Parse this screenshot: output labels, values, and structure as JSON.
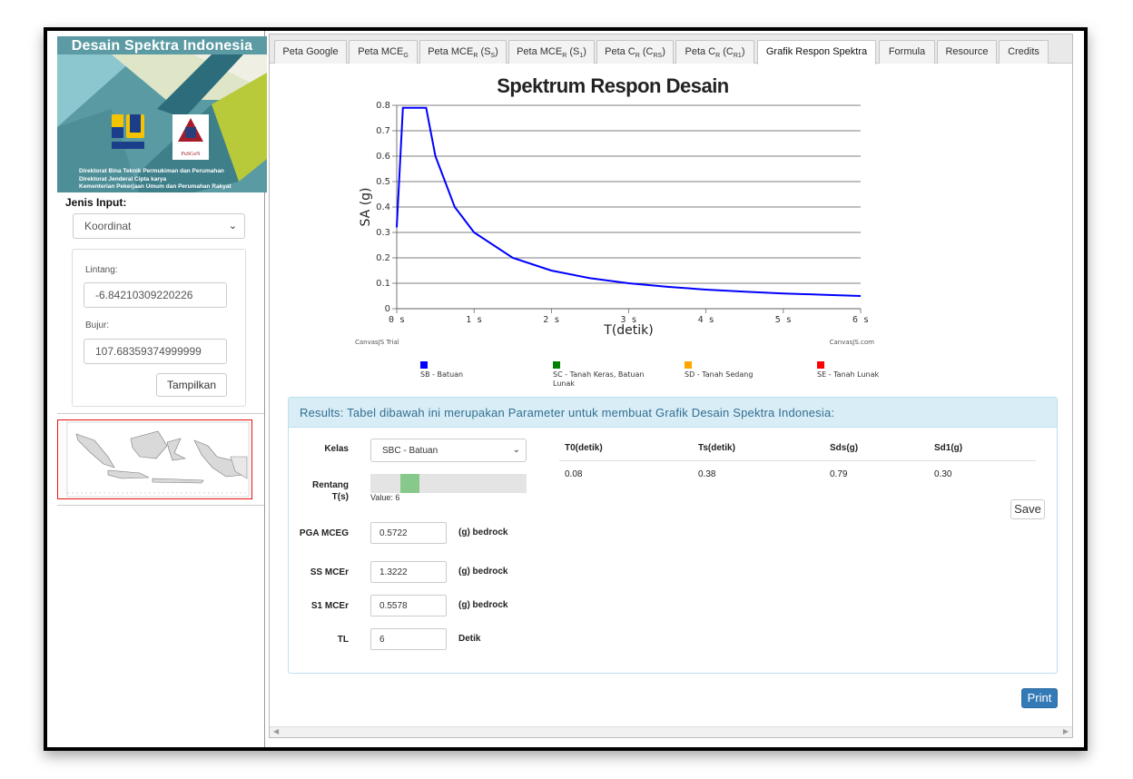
{
  "sidebar": {
    "banner_title": "Desain Spektra Indonesia",
    "banner_lines": [
      "Direktorat Bina Teknik Permukiman dan Perumahan",
      "Direktorat Jenderal Cipta karya",
      "Kementerian Pekerjaan Umum dan Perumahan Rakyat"
    ],
    "logo_pusgen_text": "PuSGeN",
    "jenis_input_label": "Jenis Input:",
    "jenis_input_value": "Koordinat",
    "lintang_label": "Lintang:",
    "lintang_value": "-6.84210309220226",
    "bujur_label": "Bujur:",
    "bujur_value": "107.68359374999999",
    "tampilkan_label": "Tampilkan"
  },
  "tabs": [
    {
      "label": "Peta Google",
      "sub": "",
      "suffix": "",
      "active": false
    },
    {
      "label": "Peta MCE",
      "sub": "G",
      "suffix": "",
      "active": false
    },
    {
      "label": "Peta MCE",
      "sub": "R",
      "suffix": " (S",
      "sub2": "S",
      "end": ")",
      "active": false
    },
    {
      "label": "Peta MCE",
      "sub": "R",
      "suffix": " (S",
      "sub2": "1",
      "end": ")",
      "active": false
    },
    {
      "label": "Peta C",
      "sub": "R",
      "suffix": " (C",
      "sub2": "RS",
      "end": ")",
      "active": false
    },
    {
      "label": "Peta C",
      "sub": "R",
      "suffix": " (C",
      "sub2": "R1",
      "end": ")",
      "active": false
    },
    {
      "label": "Grafik Respon Spektra",
      "sub": "",
      "suffix": "",
      "active": true
    },
    {
      "label": "Formula",
      "sub": "",
      "suffix": "",
      "active": false
    },
    {
      "label": "Resource",
      "sub": "",
      "suffix": "",
      "active": false
    },
    {
      "label": "Credits",
      "sub": "",
      "suffix": "",
      "active": false
    }
  ],
  "chart_data": {
    "type": "line",
    "title": "Spektrum Respon Desain",
    "xlabel": "T(detik)",
    "ylabel": "SA (g)",
    "xlim": [
      0,
      6
    ],
    "ylim": [
      0,
      0.8
    ],
    "x_ticks": [
      "0 s",
      "1 s",
      "2 s",
      "3 s",
      "4 s",
      "5 s",
      "6 s"
    ],
    "y_ticks": [
      "0",
      "0.1",
      "0.2",
      "0.3",
      "0.4",
      "0.5",
      "0.6",
      "0.7",
      "0.8"
    ],
    "grid": true,
    "credit_left": "CanvasJS Trial",
    "credit_right": "CanvasJS.com",
    "legend_position": "bottom",
    "legend": [
      {
        "label": "SB - Batuan",
        "color": "#0000ff"
      },
      {
        "label": "SC - Tanah Keras, Batuan Lunak",
        "color": "#008000"
      },
      {
        "label": "SD - Tanah Sedang",
        "color": "#ffa500"
      },
      {
        "label": "SE - Tanah Lunak",
        "color": "#ff0000"
      }
    ],
    "series": [
      {
        "name": "SB - Batuan",
        "color": "#0000ff",
        "x": [
          0,
          0.08,
          0.38,
          0.5,
          0.75,
          1,
          1.5,
          2,
          2.5,
          3,
          3.5,
          4,
          4.5,
          5,
          5.5,
          6
        ],
        "y": [
          0.32,
          0.79,
          0.79,
          0.6,
          0.4,
          0.3,
          0.2,
          0.15,
          0.12,
          0.1,
          0.086,
          0.075,
          0.067,
          0.06,
          0.055,
          0.05
        ]
      }
    ]
  },
  "results": {
    "header": "Results: Tabel dibawah ini merupakan Parameter untuk membuat Grafik Desain Spektra Indonesia:",
    "kelas_label": "Kelas",
    "kelas_value": "SBC - Batuan",
    "rentang_label": "Rentang T(s)",
    "rentang_value": 6,
    "rentang_max": 10,
    "rentang_value_text": "Value: 6",
    "pga_label": "PGA MCEG",
    "pga_value": "0.5722",
    "pga_unit": "(g) bedrock",
    "ss_label": "SS MCEr",
    "ss_value": "1.3222",
    "ss_unit": "(g) bedrock",
    "s1_label": "S1 MCEr",
    "s1_value": "0.5578",
    "s1_unit": "(g) bedrock",
    "tl_label": "TL",
    "tl_value": "6",
    "tl_unit": "Detik",
    "table_headers": [
      "T0(detik)",
      "Ts(detik)",
      "Sds(g)",
      "Sd1(g)"
    ],
    "table_values": [
      "0.08",
      "0.38",
      "0.79",
      "0.30"
    ],
    "save_label": "Save",
    "print_label": "Print"
  },
  "colors": {
    "accent": "#337ab7",
    "results_header_bg": "#d9edf7",
    "results_header_text": "#31708f",
    "slider_handle": "#86c98a"
  }
}
